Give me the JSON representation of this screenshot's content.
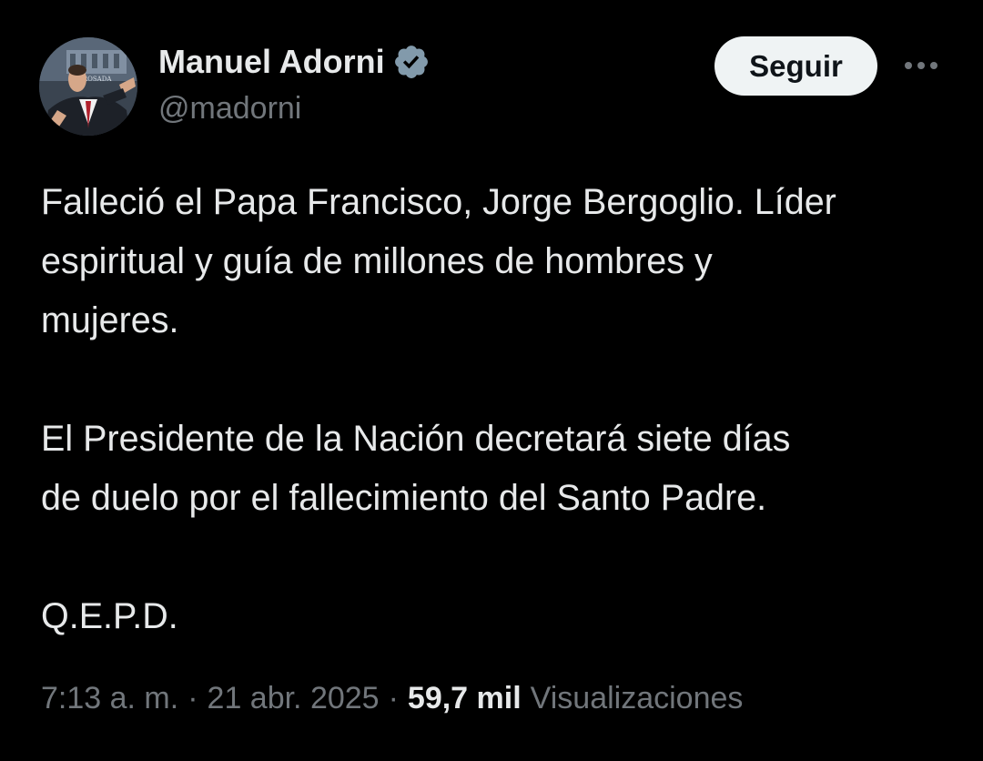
{
  "author": {
    "display_name": "Manuel Adorni",
    "handle": "@madorni",
    "verified_icon": "verified-badge-icon",
    "avatar_caption": "A ROSADA"
  },
  "actions": {
    "follow_label": "Seguir",
    "more_icon": "more-options-icon"
  },
  "tweet": {
    "paragraphs": [
      "Falleció el Papa Francisco, Jorge Bergoglio. Líder\nespiritual y guía de millones de hombres y\nmujeres.",
      "El Presidente de la Nación decretará siete días\nde duelo por el fallecimiento del Santo Padre.",
      "Q.E.P.D."
    ]
  },
  "meta": {
    "time": "7:13 a. m.",
    "separator": "·",
    "date": "21 abr. 2025",
    "views_count": "59,7 mil",
    "views_label": "Visualizaciones"
  },
  "colors": {
    "background": "#000000",
    "text_primary": "#e7e9ea",
    "text_secondary": "#71767b",
    "button_bg": "#eff3f4",
    "verified": "#829aab"
  }
}
